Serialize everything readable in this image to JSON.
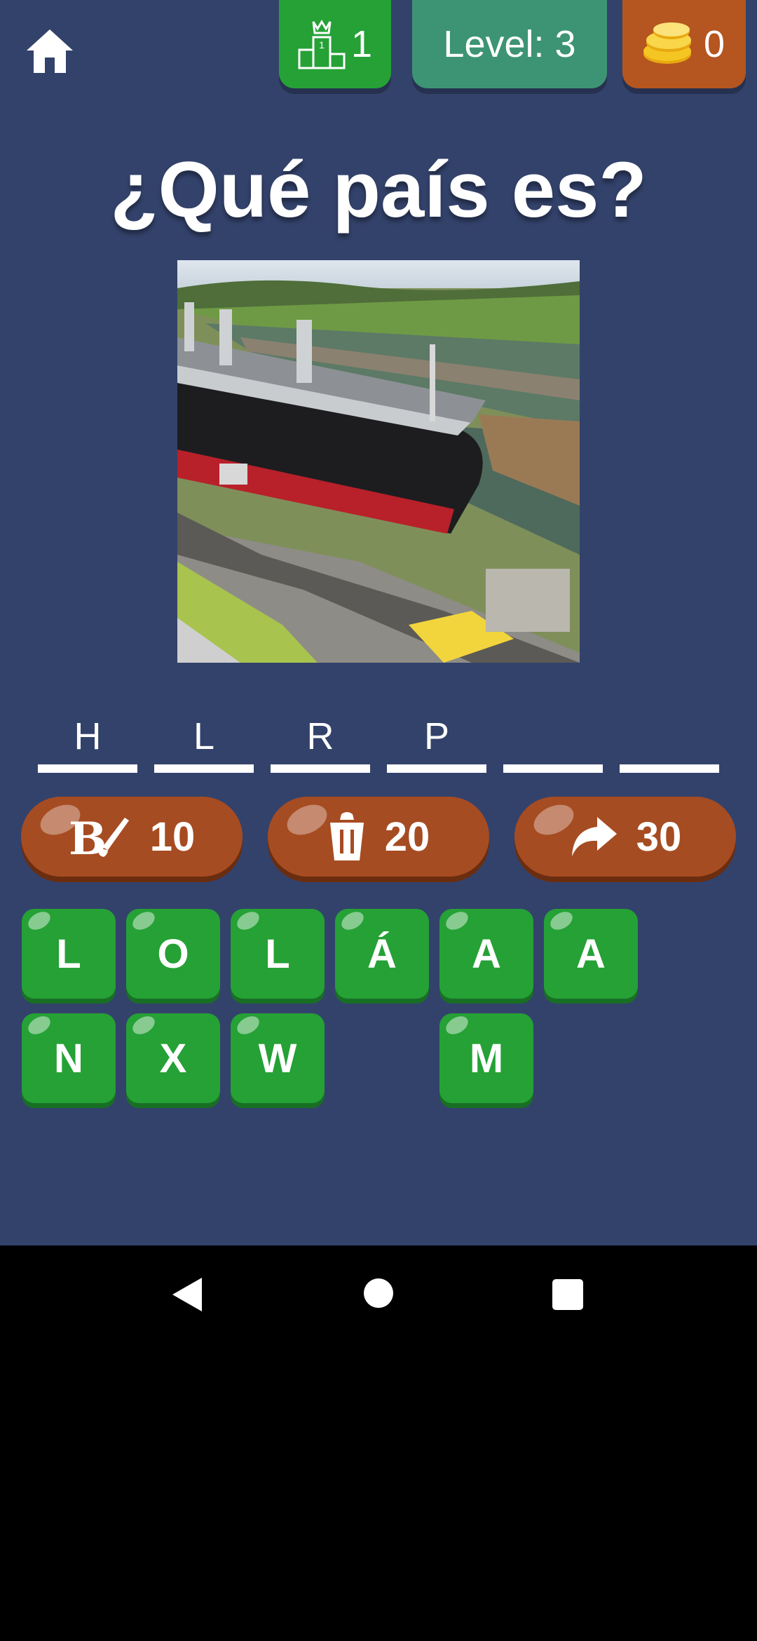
{
  "topbar": {
    "rank_value": "1",
    "level_label": "Level: 3",
    "coins_value": "0"
  },
  "question": "¿Qué país es?",
  "answer_slots": [
    "H",
    "L",
    "R",
    "P",
    "",
    ""
  ],
  "hints": [
    {
      "icon": "paint-brush-letter-icon",
      "cost": "10"
    },
    {
      "icon": "trash-can-icon",
      "cost": "20"
    },
    {
      "icon": "skip-arrow-icon",
      "cost": "30"
    }
  ],
  "letters_row1": [
    "L",
    "O",
    "L",
    "Á",
    "A",
    "A"
  ],
  "letters_row2": [
    "N",
    "X",
    "W",
    "",
    "M",
    ""
  ],
  "colors": {
    "background": "#33426b",
    "tile_green": "#25a136",
    "hint_brown": "#a64c22",
    "level_teal": "#3d9474",
    "coins_orange": "#b55520"
  }
}
